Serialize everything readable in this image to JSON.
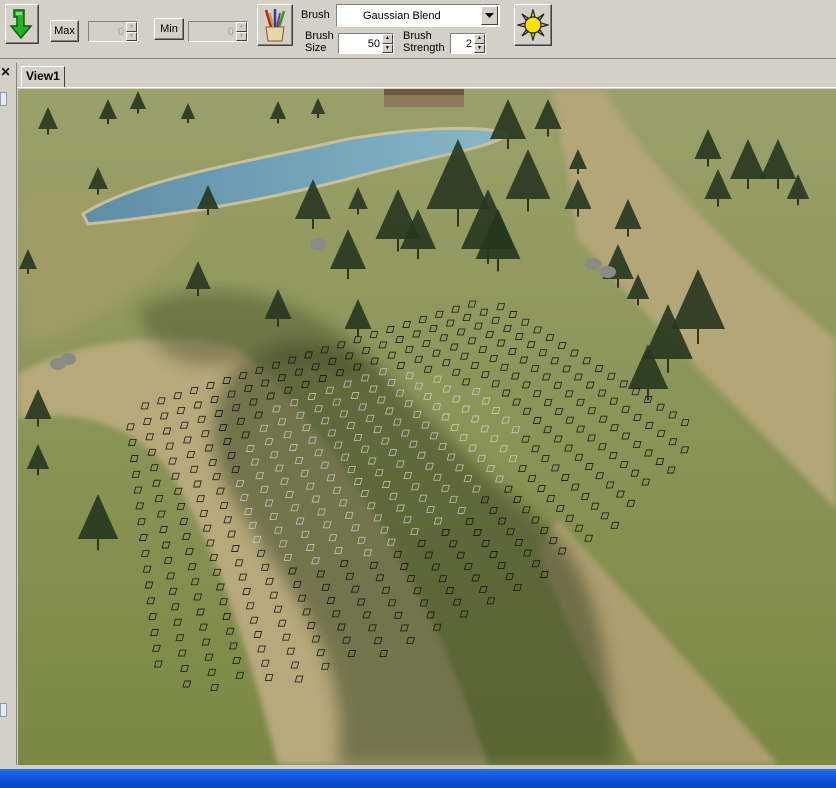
{
  "toolbar": {
    "apply_icon": "green-down-arrow-icon",
    "max_label": "Max",
    "max_value": "0",
    "min_label": "Min",
    "min_value": "0",
    "brushes_icon": "paint-brushes-icon",
    "brush_label": "Brush",
    "brush_value": "Gaussian Blend",
    "brush_size_label_1": "Brush",
    "brush_size_label_2": "Size",
    "brush_size_value": "50",
    "brush_strength_label_1": "Brush",
    "brush_strength_label_2": "Strength",
    "brush_strength_value": "2",
    "lighting_icon": "sun-icon"
  },
  "panel": {
    "close_label": "✕"
  },
  "tabs": [
    {
      "label": "View1"
    }
  ],
  "colors": {
    "grass": "#7d8a46",
    "dirt": "#b0a071",
    "water": "#6a9fb0",
    "shadow": "#3f4627",
    "tree": "#26361f",
    "status_bar": "#0a50d8"
  }
}
